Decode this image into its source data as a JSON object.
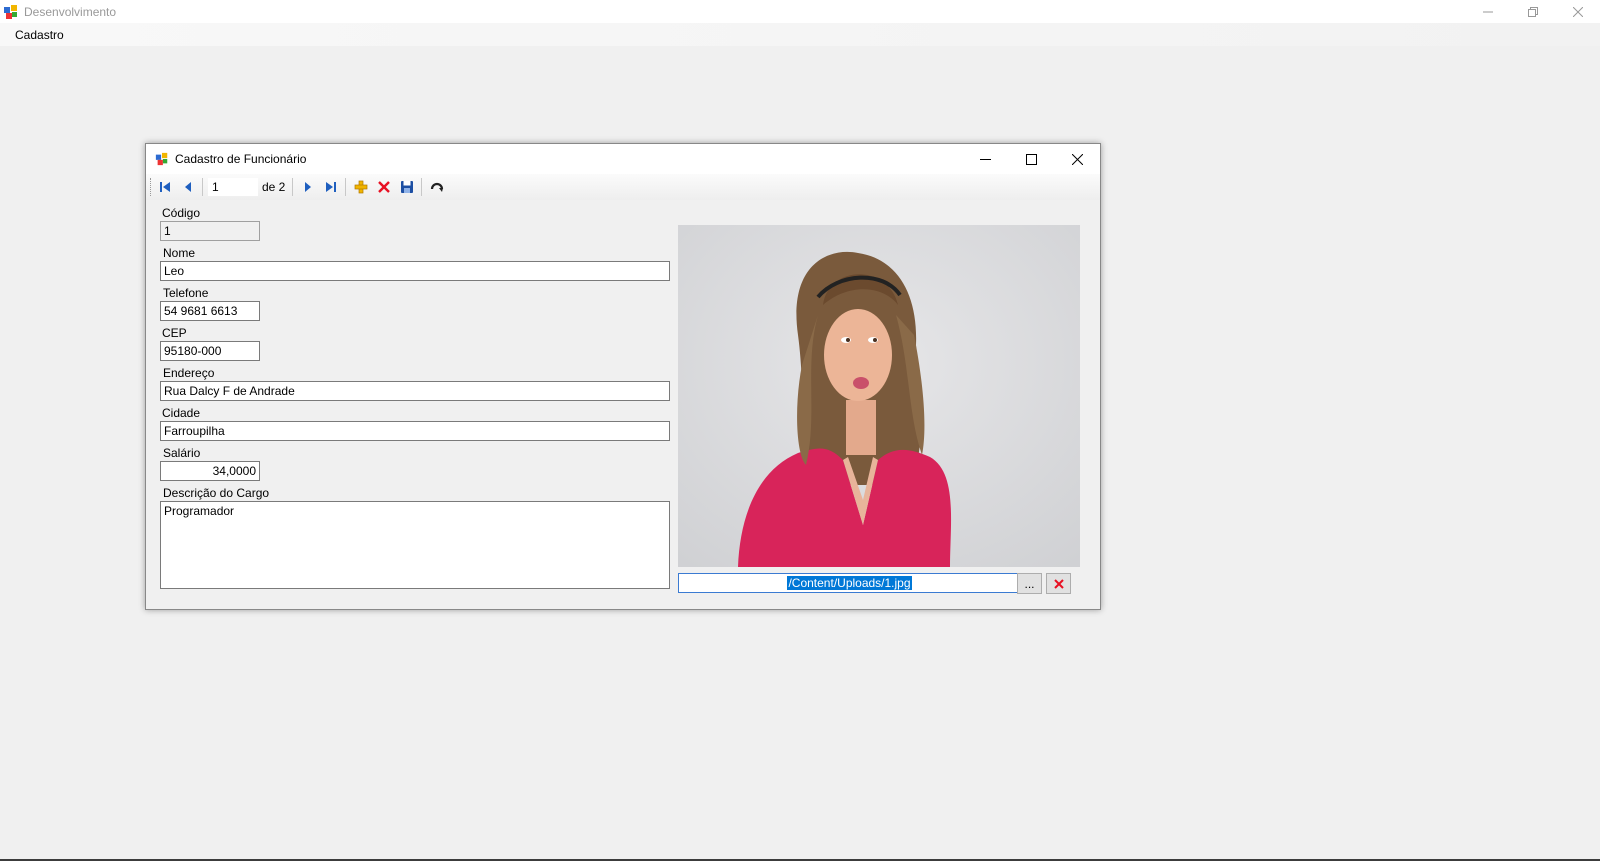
{
  "app": {
    "title": "Desenvolvimento",
    "menu": [
      "Cadastro"
    ]
  },
  "child": {
    "title": "Cadastro de Funcionário",
    "toolbar": {
      "position": "1",
      "count": "de 2"
    }
  },
  "form": {
    "codigo_label": "Código",
    "codigo_value": "1",
    "nome_label": "Nome",
    "nome_value": "Leo",
    "telefone_label": "Telefone",
    "telefone_value": "54 9681 6613",
    "cep_label": "CEP",
    "cep_value": "95180-000",
    "endereco_label": "Endereço",
    "endereco_value": "Rua Dalcy F de Andrade",
    "cidade_label": "Cidade",
    "cidade_value": "Farroupilha",
    "salario_label": "Salário",
    "salario_value": "34,0000",
    "cargo_label": "Descrição do Cargo",
    "cargo_value": "Programador"
  },
  "photo": {
    "path": "/Content/Uploads/1.jpg",
    "browse_label": "...",
    "remove_label": "✕"
  },
  "colors": {
    "accent_blue": "#0078d7",
    "nav_blue": "#1f5fbf",
    "delete_red": "#e81123",
    "shirt_pink": "#d8245a"
  }
}
